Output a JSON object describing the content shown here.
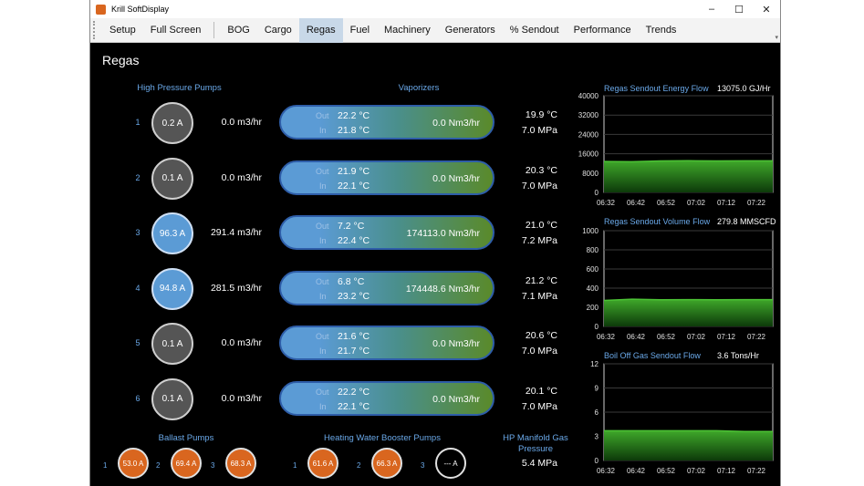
{
  "window": {
    "title": "Krill SoftDisplay",
    "minimize": "–",
    "maximize": "☐",
    "close": "✕"
  },
  "menu": {
    "left": [
      "Setup",
      "Full Screen"
    ],
    "tabs": [
      "BOG",
      "Cargo",
      "Regas",
      "Fuel",
      "Machinery",
      "Generators",
      "% Sendout",
      "Performance",
      "Trends"
    ],
    "active": "Regas"
  },
  "page": {
    "title": "Regas"
  },
  "sections": {
    "hp_pumps": "High Pressure Pumps",
    "vaporizers": "Vaporizers",
    "ballast": "Ballast Pumps",
    "hwbp": "Heating Water Booster Pumps",
    "hp_manifold": "HP Manifold Gas Pressure"
  },
  "vaporizer_labels": {
    "out": "Out",
    "in": "In"
  },
  "rows": [
    {
      "idx": "1",
      "current": "0.2 A",
      "on": false,
      "flow": "0.0 m3/hr",
      "out_temp": "22.2 °C",
      "in_temp": "21.8 °C",
      "vflow": "0.0 Nm3/hr",
      "temp": "19.9 °C",
      "press": "7.0 MPa"
    },
    {
      "idx": "2",
      "current": "0.1 A",
      "on": false,
      "flow": "0.0 m3/hr",
      "out_temp": "21.9 °C",
      "in_temp": "22.1 °C",
      "vflow": "0.0 Nm3/hr",
      "temp": "20.3 °C",
      "press": "7.0 MPa"
    },
    {
      "idx": "3",
      "current": "96.3 A",
      "on": true,
      "flow": "291.4 m3/hr",
      "out_temp": "7.2 °C",
      "in_temp": "22.4 °C",
      "vflow": "174113.0 Nm3/hr",
      "temp": "21.0 °C",
      "press": "7.2 MPa"
    },
    {
      "idx": "4",
      "current": "94.8 A",
      "on": true,
      "flow": "281.5 m3/hr",
      "out_temp": "6.8 °C",
      "in_temp": "23.2 °C",
      "vflow": "174448.6 Nm3/hr",
      "temp": "21.2 °C",
      "press": "7.1 MPa"
    },
    {
      "idx": "5",
      "current": "0.1 A",
      "on": false,
      "flow": "0.0 m3/hr",
      "out_temp": "21.6 °C",
      "in_temp": "21.7 °C",
      "vflow": "0.0 Nm3/hr",
      "temp": "20.6 °C",
      "press": "7.0 MPa"
    },
    {
      "idx": "6",
      "current": "0.1 A",
      "on": false,
      "flow": "0.0 m3/hr",
      "out_temp": "22.2 °C",
      "in_temp": "22.1 °C",
      "vflow": "0.0 Nm3/hr",
      "temp": "20.1 °C",
      "press": "7.0 MPa"
    }
  ],
  "ballast_pumps": [
    {
      "idx": "1",
      "current": "53.0 A",
      "on": true
    },
    {
      "idx": "2",
      "current": "69.4 A",
      "on": true
    },
    {
      "idx": "3",
      "current": "68.3 A",
      "on": true
    }
  ],
  "hwbp": [
    {
      "idx": "1",
      "current": "61.6 A",
      "on": true
    },
    {
      "idx": "2",
      "current": "66.3 A",
      "on": true
    },
    {
      "idx": "3",
      "current": "--- A",
      "on": false
    }
  ],
  "hp_manifold_value": "5.4 MPa",
  "colors": {
    "accent": "#6aa8e8",
    "pump_on": "#5b9bd5",
    "pump_off": "#555555",
    "pump_orange": "#d9661f",
    "trend": "#2f8f1f"
  },
  "chart_data": [
    {
      "type": "area",
      "title": "Regas Sendout Energy Flow",
      "readout": "13075.0 GJ/Hr",
      "x": [
        "06:32",
        "06:42",
        "06:52",
        "07:02",
        "07:12",
        "07:22"
      ],
      "yticks": [
        0,
        8000,
        16000,
        24000,
        32000,
        40000
      ],
      "ylim": [
        0,
        40000
      ],
      "values": [
        12800,
        12700,
        13000,
        13100,
        13000,
        13050,
        13075
      ]
    },
    {
      "type": "area",
      "title": "Regas Sendout Volume Flow",
      "readout": "279.8 MMSCFD",
      "x": [
        "06:32",
        "06:42",
        "06:52",
        "07:02",
        "07:12",
        "07:22"
      ],
      "yticks": [
        0,
        200,
        400,
        600,
        800,
        1000
      ],
      "ylim": [
        0,
        1000
      ],
      "values": [
        272,
        285,
        278,
        280,
        279,
        280,
        279.8
      ]
    },
    {
      "type": "area",
      "title": "Boil Off Gas Sendout Flow",
      "readout": "3.6 Tons/Hr",
      "x": [
        "06:32",
        "06:42",
        "06:52",
        "07:02",
        "07:12",
        "07:22"
      ],
      "yticks": [
        0,
        3,
        6,
        9,
        12
      ],
      "ylim": [
        0,
        12
      ],
      "values": [
        3.7,
        3.7,
        3.7,
        3.7,
        3.7,
        3.6,
        3.6
      ]
    }
  ]
}
